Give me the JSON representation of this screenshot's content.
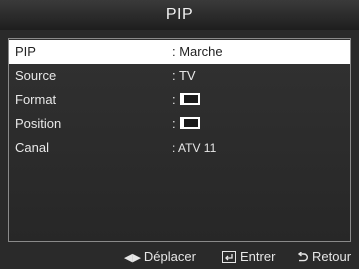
{
  "title": "PIP",
  "menu": {
    "items": [
      {
        "label": "PIP",
        "value": ": Marche",
        "selected": true
      },
      {
        "label": "Source",
        "value": ": TV",
        "selected": false
      },
      {
        "label": "Format",
        "value": ":",
        "icon": "pip-format-icon",
        "selected": false
      },
      {
        "label": "Position",
        "value": ":",
        "icon": "pip-position-icon",
        "selected": false
      },
      {
        "label": "Canal",
        "value": ": ATV 11",
        "selected": false
      }
    ]
  },
  "footer": {
    "move_label": "Déplacer",
    "move_icon": "left-right-arrows-icon",
    "enter_label": "Entrer",
    "enter_icon": "enter-icon",
    "return_label": "Retour",
    "return_icon": "return-icon"
  },
  "colors": {
    "background": "#2a2a2a",
    "selected_row": "#ffffff",
    "panel_border": "#8a8a8a",
    "text": "#e8e8e8"
  }
}
